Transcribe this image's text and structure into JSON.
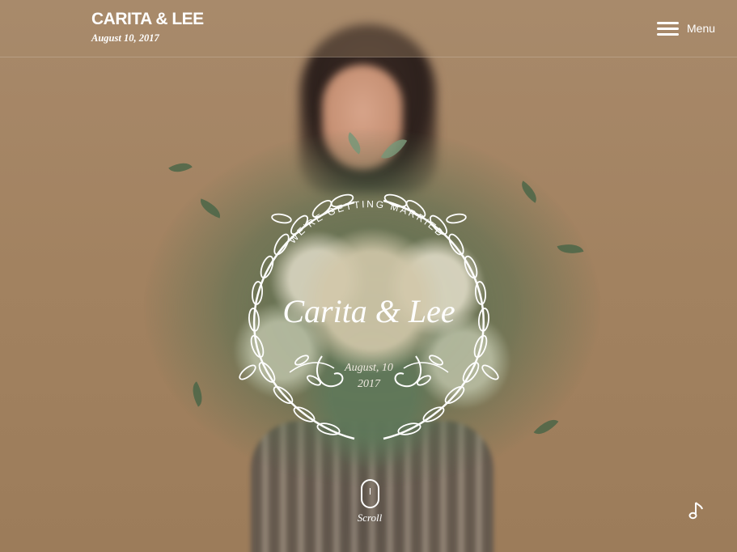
{
  "header": {
    "title": "CARITA & LEE",
    "date": "August 10, 2017",
    "menu_label": "Menu"
  },
  "emblem": {
    "arc_text": "WE'RE GETTING MARRIED",
    "names": "Carita & Lee",
    "date_line1": "August, 10",
    "date_line2": "2017"
  },
  "scroll": {
    "label": "Scroll"
  },
  "icons": {
    "menu": "hamburger-icon",
    "scroll": "mouse-icon",
    "music": "music-note-icon"
  },
  "colors": {
    "text": "#ffffff",
    "background": "#a4835f"
  }
}
